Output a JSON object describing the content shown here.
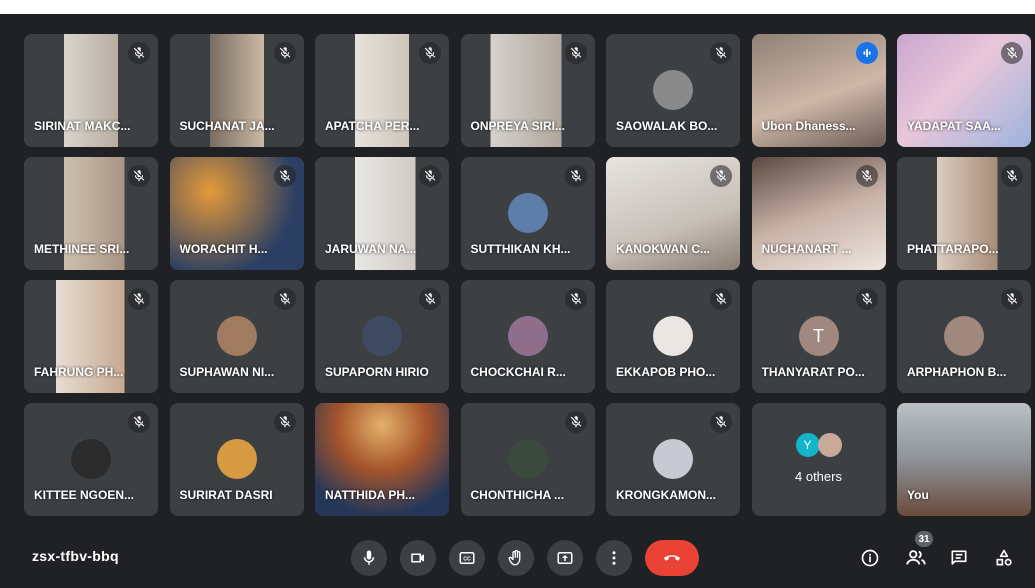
{
  "meeting": {
    "code": "zsx-tfbv-bbq",
    "participant_count": "31"
  },
  "participants": [
    {
      "name": "SIRINAT MAKC...",
      "type": "video",
      "muted": true
    },
    {
      "name": "SUCHANAT JA...",
      "type": "video",
      "muted": true
    },
    {
      "name": "APATCHA PER...",
      "type": "video",
      "muted": true
    },
    {
      "name": "ONPREYA SIRI...",
      "type": "video",
      "muted": true
    },
    {
      "name": "SAOWALAK BO...",
      "type": "avatar",
      "muted": true
    },
    {
      "name": "Ubon Dhaness...",
      "type": "video",
      "muted": false,
      "speaking": true
    },
    {
      "name": "YADAPAT SAA...",
      "type": "video",
      "muted": true
    },
    {
      "name": "METHINEE SRI...",
      "type": "video",
      "muted": true
    },
    {
      "name": "WORACHIT H...",
      "type": "video",
      "muted": true
    },
    {
      "name": "JARUWAN NA...",
      "type": "video",
      "muted": true
    },
    {
      "name": "SUTTHIKAN KH...",
      "type": "avatar",
      "muted": true
    },
    {
      "name": "KANOKWAN C...",
      "type": "video",
      "muted": true
    },
    {
      "name": "NUCHANART ...",
      "type": "video",
      "muted": true
    },
    {
      "name": "PHATTARAPO...",
      "type": "video",
      "muted": true
    },
    {
      "name": "FAHRUNG PH...",
      "type": "video",
      "muted": true
    },
    {
      "name": "SUPHAWAN NI...",
      "type": "avatar",
      "muted": true
    },
    {
      "name": "SUPAPORN HIRIO",
      "type": "avatar",
      "muted": true
    },
    {
      "name": "CHOCKCHAI R...",
      "type": "avatar",
      "muted": true
    },
    {
      "name": "EKKAPOB PHO...",
      "type": "avatar",
      "muted": true
    },
    {
      "name": "THANYARAT PO...",
      "type": "initial",
      "initial": "T",
      "muted": true
    },
    {
      "name": "ARPHAPHON B...",
      "type": "avatar",
      "muted": true
    },
    {
      "name": "KITTEE NGOEN...",
      "type": "avatar",
      "muted": true
    },
    {
      "name": "SURIRAT DASRI",
      "type": "avatar",
      "muted": true
    },
    {
      "name": "NATTHIDA PH...",
      "type": "video",
      "muted": false
    },
    {
      "name": "CHONTHICHA ...",
      "type": "avatar",
      "muted": true
    },
    {
      "name": "KRONGKAMON...",
      "type": "avatar",
      "muted": true
    },
    {
      "name": "",
      "type": "others",
      "others_label": "4 others",
      "initial": "Y"
    },
    {
      "name": "You",
      "type": "video",
      "muted": false
    }
  ],
  "controls": {
    "mic": "mic-icon",
    "camera": "camera-icon",
    "captions": "captions-icon",
    "raise_hand": "hand-icon",
    "present": "present-icon",
    "more": "more-icon",
    "end_call": "end-call-icon"
  },
  "colors": {
    "background": "#202124",
    "tile": "#3c4043",
    "end_call": "#ea4335",
    "speaking": "#8ab4f8",
    "initial_avatar": "#a1887f"
  }
}
